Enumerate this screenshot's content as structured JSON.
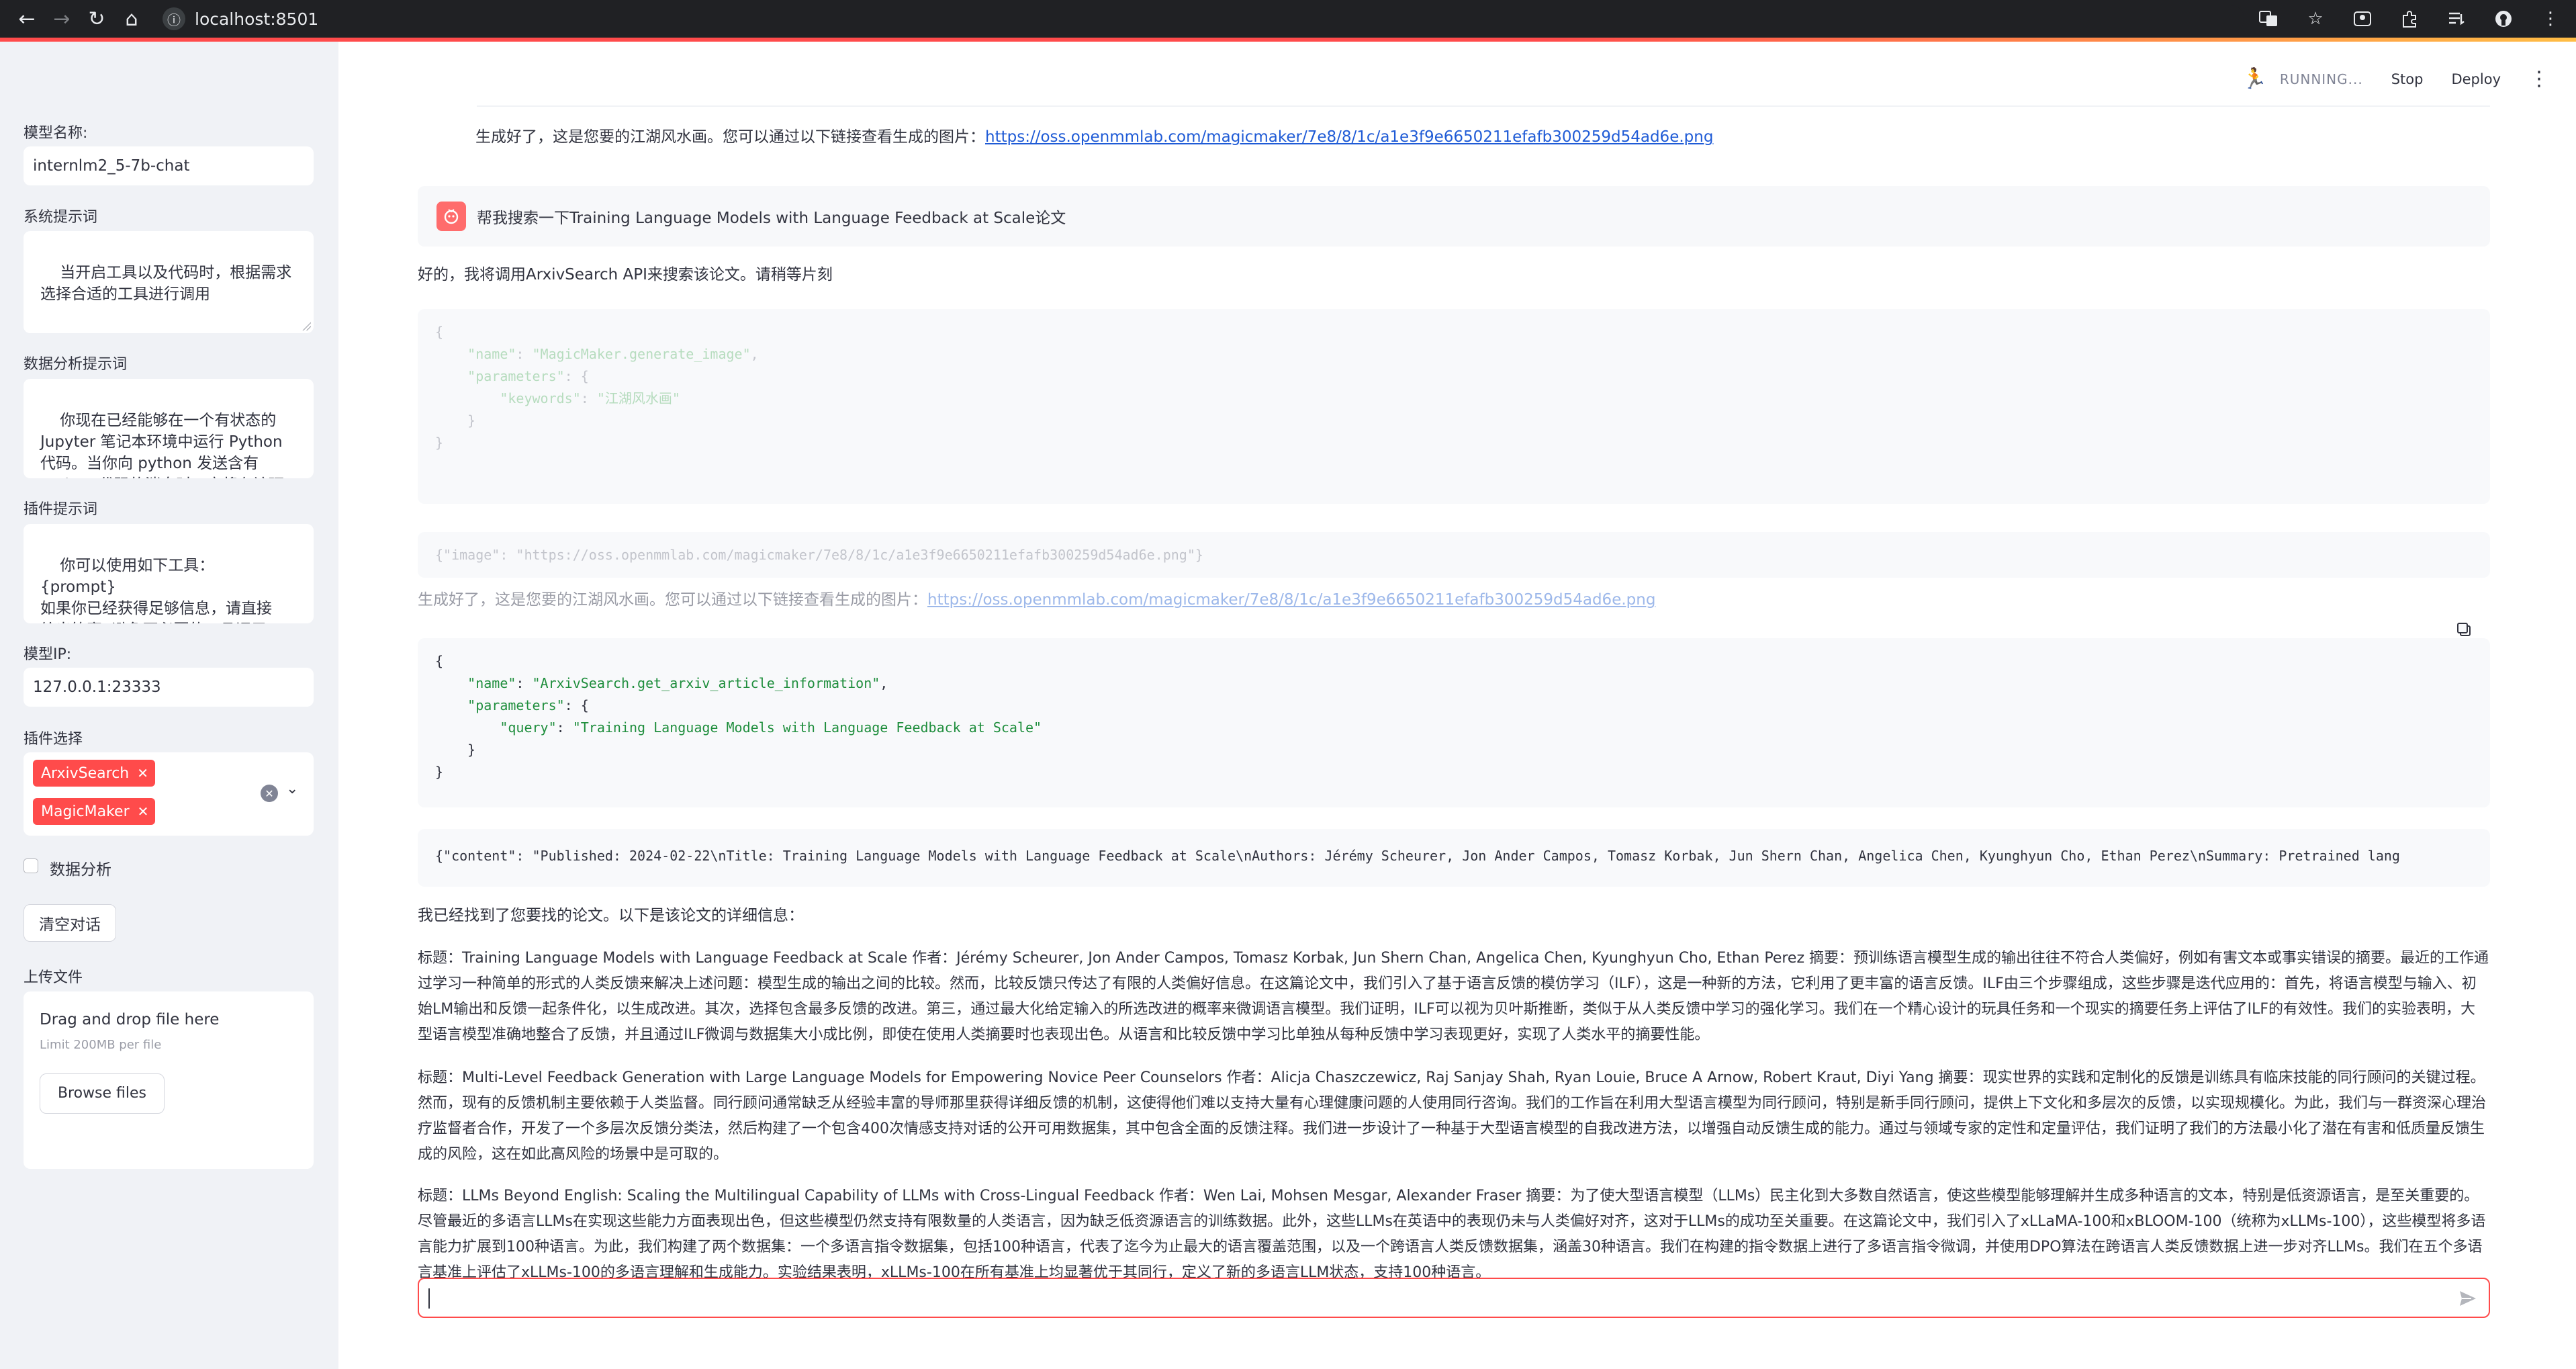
{
  "browser": {
    "url": "localhost:8501"
  },
  "app_status": {
    "running": "RUNNING...",
    "stop": "Stop",
    "deploy": "Deploy"
  },
  "sidebar": {
    "model_name_label": "模型名称:",
    "model_name_value": "internlm2_5-7b-chat",
    "system_prompt_label": "系统提示词",
    "system_prompt_value": "当开启工具以及代码时，根据需求\n选择合适的工具进行调用",
    "data_prompt_label": "数据分析提示词",
    "data_prompt_value": "你现在已经能够在一个有状态的\nJupyter 笔记本环境中运行 Python\n代码。当你向 python 发送含有\nPython 代码的消息时，它将在该环",
    "plugin_prompt_label": "插件提示词",
    "plugin_prompt_value": "你可以使用如下工具：\n{prompt}\n如果你已经获得足够信息，请直接\n给出答案. 避免不必要的工具调用!",
    "model_ip_label": "模型IP:",
    "model_ip_value": "127.0.0.1:23333",
    "plugin_select_label": "插件选择",
    "plugins": [
      "ArxivSearch",
      "MagicMaker"
    ],
    "data_analysis_label": "数据分析",
    "clear_button": "清空对话",
    "upload_label": "上传文件",
    "drop_title": "Drag and drop file here",
    "drop_limit": "Limit 200MB per file",
    "browse_button": "Browse files"
  },
  "chat": {
    "msg_image_prefix": "生成好了，这是您要的江湖风水画。您可以通过以下链接查看生成的图片：",
    "image_link": "https://oss.openmmlab.com/magicmaker/7e8/8/1c/a1e3f9e6650211efafb300259d54ad6e.png",
    "user_message": "帮我搜索一下Training Language Models with Language Feedback at Scale论文",
    "assistant_intro": "好的，我将调用ArxivSearch API来搜索该论文。请稍等片刻",
    "code_generate_image": {
      "open": "{",
      "name_key": "\"name\"",
      "name_val": "\"MagicMaker.generate_image\"",
      "params_key": "\"parameters\"",
      "kw_key": "\"keywords\"",
      "kw_val": "\"江湖风水画\"",
      "close_inner": "}",
      "close": "}"
    },
    "image_result": "{\"image\": \"https://oss.openmmlab.com/magicmaker/7e8/8/1c/a1e3f9e6650211efafb300259d54ad6e.png\"}",
    "code_arxiv": {
      "open": "{",
      "name_key": "\"name\"",
      "name_val": "\"ArxivSearch.get_arxiv_article_information\"",
      "params_key": "\"parameters\"",
      "query_key": "\"query\"",
      "query_val": "\"Training Language Models with Language Feedback at Scale\"",
      "close_inner": "}",
      "close": "}"
    },
    "arxiv_result": "{\"content\": \"Published: 2024-02-22\\nTitle: Training Language Models with Language Feedback at Scale\\nAuthors: Jérémy Scheurer, Jon Ander Campos, Tomasz Korbak, Jun Shern Chan, Angelica Chen, Kyunghyun Cho, Ethan Perez\\nSummary: Pretrained lang",
    "found_intro": "我已经找到了您要找的论文。以下是该论文的详细信息：",
    "paper1": "标题：Training Language Models with Language Feedback at Scale 作者：Jérémy Scheurer, Jon Ander Campos, Tomasz Korbak, Jun Shern Chan, Angelica Chen, Kyunghyun Cho, Ethan Perez 摘要：预训练语言模型生成的输出往往不符合人类偏好，例如有害文本或事实错误的摘要。最近的工作通过学习一种简单的形式的人类反馈来解决上述问题：模型生成的输出之间的比较。然而，比较反馈只传达了有限的人类偏好信息。在这篇论文中，我们引入了基于语言反馈的模仿学习（ILF），这是一种新的方法，它利用了更丰富的语言反馈。ILF由三个步骤组成，这些步骤是迭代应用的：首先，将语言模型与输入、初始LM输出和反馈一起条件化，以生成改进。其次，选择包含最多反馈的改进。第三，通过最大化给定输入的所选改进的概率来微调语言模型。我们证明，ILF可以视为贝叶斯推断，类似于从人类反馈中学习的强化学习。我们在一个精心设计的玩具任务和一个现实的摘要任务上评估了ILF的有效性。我们的实验表明，大型语言模型准确地整合了反馈，并且通过ILF微调与数据集大小成比例，即使在使用人类摘要时也表现出色。从语言和比较反馈中学习比单独从每种反馈中学习表现更好，实现了人类水平的摘要性能。",
    "paper2": "标题：Multi-Level Feedback Generation with Large Language Models for Empowering Novice Peer Counselors 作者：Alicja Chaszczewicz, Raj Sanjay Shah, Ryan Louie, Bruce A Arnow, Robert Kraut, Diyi Yang 摘要：现实世界的实践和定制化的反馈是训练具有临床技能的同行顾问的关键过程。然而，现有的反馈机制主要依赖于人类监督。同行顾问通常缺乏从经验丰富的导师那里获得详细反馈的机制，这使得他们难以支持大量有心理健康问题的人使用同行咨询。我们的工作旨在利用大型语言模型为同行顾问，特别是新手同行顾问，提供上下文化和多层次的反馈，以实现规模化。为此，我们与一群资深心理治疗监督者合作，开发了一个多层次反馈分类法，然后构建了一个包含400次情感支持对话的公开可用数据集，其中包含全面的反馈注释。我们进一步设计了一种基于大型语言模型的自我改进方法，以增强自动反馈生成的能力。通过与领域专家的定性和定量评估，我们证明了我们的方法最小化了潜在有害和低质量反馈生成的风险，这在如此高风险的场景中是可取的。",
    "paper3": "标题：LLMs Beyond English: Scaling the Multilingual Capability of LLMs with Cross-Lingual Feedback 作者：Wen Lai, Mohsen Mesgar, Alexander Fraser 摘要：为了使大型语言模型（LLMs）民主化到大多数自然语言，使这些模型能够理解并生成多种语言的文本，特别是低资源语言，是至关重要的。尽管最近的多语言LLMs在实现这些能力方面表现出色，但这些模型仍然支持有限数量的人类语言，因为缺乏低资源语言的训练数据。此外，这些LLMs在英语中的表现仍未与人类偏好对齐，这对于LLMs的成功至关重要。在这篇论文中，我们引入了xLLaMA-100和xBLOOM-100（统称为xLLMs-100），这些模型将多语言能力扩展到100种语言。为此，我们构建了两个数据集：一个多语言指令数据集，包括100种语言，代表了迄今为止最大的语言覆盖范围，以及一个跨语言人类反馈数据集，涵盖30种语言。我们在构建的指令数据上进行了多语言指令微调，并使用DPO算法在跨语言人类反馈数据上进一步对齐LLMs。我们在五个多语言基准上评估了xLLMs-100的多语言理解和生成能力。实验结果表明，xLLMs-100在所有基准上均显著优于其同行，定义了新的多语言LLM状态，支持100种语言。"
  }
}
